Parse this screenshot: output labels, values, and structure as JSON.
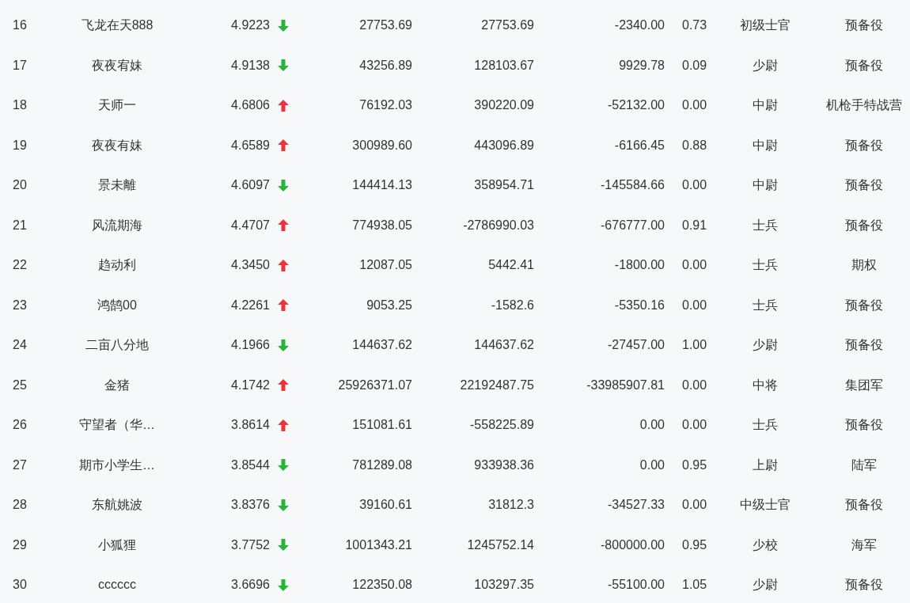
{
  "rows": [
    {
      "rank": "16",
      "name": "飞龙在天888",
      "score": "4.9223",
      "rising": false,
      "column_5": "27753.69",
      "column_6": "27753.69",
      "column_7": "-2340.00",
      "column_8": "0.73",
      "title": "初级士官",
      "unit": "预备役"
    },
    {
      "rank": "17",
      "name": "夜夜宥妹",
      "score": "4.9138",
      "rising": false,
      "column_5": "43256.89",
      "column_6": "128103.67",
      "column_7": "9929.78",
      "column_8": "0.09",
      "title": "少尉",
      "unit": "预备役"
    },
    {
      "rank": "18",
      "name": "天师一",
      "score": "4.6806",
      "rising": true,
      "column_5": "76192.03",
      "column_6": "390220.09",
      "column_7": "-52132.00",
      "column_8": "0.00",
      "title": "中尉",
      "unit": "机枪手特战营"
    },
    {
      "rank": "19",
      "name": "夜夜有妹",
      "score": "4.6589",
      "rising": true,
      "column_5": "300989.60",
      "column_6": "443096.89",
      "column_7": "-6166.45",
      "column_8": "0.88",
      "title": "中尉",
      "unit": "预备役"
    },
    {
      "rank": "20",
      "name": "景未離",
      "score": "4.6097",
      "rising": false,
      "column_5": "144414.13",
      "column_6": "358954.71",
      "column_7": "-145584.66",
      "column_8": "0.00",
      "title": "中尉",
      "unit": "预备役"
    },
    {
      "rank": "21",
      "name": "风流期海",
      "score": "4.4707",
      "rising": true,
      "column_5": "774938.05",
      "column_6": "-2786990.03",
      "column_7": "-676777.00",
      "column_8": "0.91",
      "title": "士兵",
      "unit": "预备役"
    },
    {
      "rank": "22",
      "name": "趋动利",
      "score": "4.3450",
      "rising": true,
      "column_5": "12087.05",
      "column_6": "5442.41",
      "column_7": "-1800.00",
      "column_8": "0.00",
      "title": "士兵",
      "unit": "期权"
    },
    {
      "rank": "23",
      "name": "鸿鹄00",
      "score": "4.2261",
      "rising": true,
      "column_5": "9053.25",
      "column_6": "-1582.6",
      "column_7": "-5350.16",
      "column_8": "0.00",
      "title": "士兵",
      "unit": "预备役"
    },
    {
      "rank": "24",
      "name": "二亩八分地",
      "score": "4.1966",
      "rising": false,
      "column_5": "144637.62",
      "column_6": "144637.62",
      "column_7": "-27457.00",
      "column_8": "1.00",
      "title": "少尉",
      "unit": "预备役"
    },
    {
      "rank": "25",
      "name": "金猪",
      "score": "4.1742",
      "rising": true,
      "column_5": "25926371.07",
      "column_6": "22192487.75",
      "column_7": "-33985907.81",
      "column_8": "0.00",
      "title": "中将",
      "unit": "集团军"
    },
    {
      "rank": "26",
      "name": "守望者（华…",
      "score": "3.8614",
      "rising": true,
      "column_5": "151081.61",
      "column_6": "-558225.89",
      "column_7": "0.00",
      "column_8": "0.00",
      "title": "士兵",
      "unit": "预备役"
    },
    {
      "rank": "27",
      "name": "期市小学生…",
      "score": "3.8544",
      "rising": false,
      "column_5": "781289.08",
      "column_6": "933938.36",
      "column_7": "0.00",
      "column_8": "0.95",
      "title": "上尉",
      "unit": "陆军"
    },
    {
      "rank": "28",
      "name": "东航姚波",
      "score": "3.8376",
      "rising": false,
      "column_5": "39160.61",
      "column_6": "31812.3",
      "column_7": "-34527.33",
      "column_8": "0.00",
      "title": "中级士官",
      "unit": "预备役"
    },
    {
      "rank": "29",
      "name": "小狐狸",
      "score": "3.7752",
      "rising": false,
      "column_5": "1001343.21",
      "column_6": "1245752.14",
      "column_7": "-800000.00",
      "column_8": "0.95",
      "title": "少校",
      "unit": "海军"
    },
    {
      "rank": "30",
      "name": "cccccc",
      "score": "3.6696",
      "rising": false,
      "column_5": "122350.08",
      "column_6": "103297.35",
      "column_7": "-55100.00",
      "column_8": "1.05",
      "title": "少尉",
      "unit": "预备役"
    }
  ]
}
